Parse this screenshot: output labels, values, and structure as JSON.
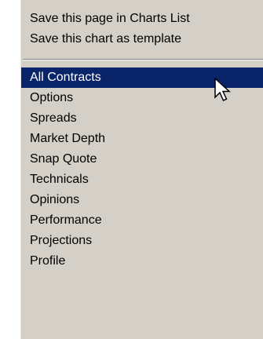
{
  "menu": {
    "top_items": [
      {
        "label": "Save this page in Charts List"
      },
      {
        "label": "Save this chart as template"
      }
    ],
    "items": [
      {
        "label": "All Contracts",
        "selected": true
      },
      {
        "label": "Options",
        "selected": false
      },
      {
        "label": "Spreads",
        "selected": false
      },
      {
        "label": "Market Depth",
        "selected": false
      },
      {
        "label": "Snap Quote",
        "selected": false
      },
      {
        "label": "Technicals",
        "selected": false
      },
      {
        "label": "Opinions",
        "selected": false
      },
      {
        "label": "Performance",
        "selected": false
      },
      {
        "label": "Projections",
        "selected": false
      },
      {
        "label": "Profile",
        "selected": false
      }
    ]
  },
  "colors": {
    "menu_background": "#d4d0c8",
    "highlight_background": "#0a246a",
    "highlight_text": "#ffffff",
    "text": "#000000"
  },
  "cursor": {
    "icon": "arrow-pointer-icon"
  }
}
